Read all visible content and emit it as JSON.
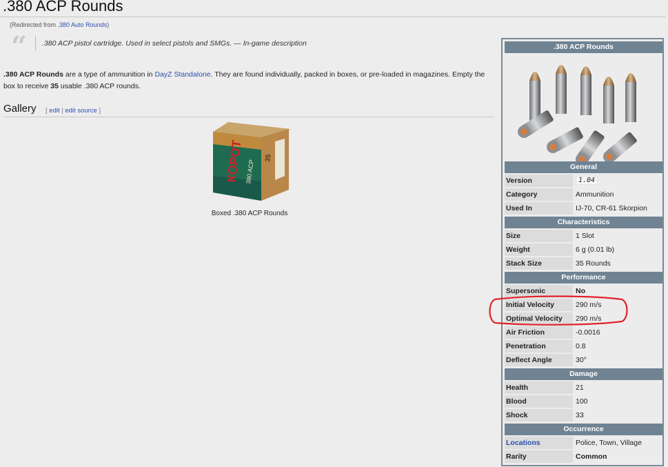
{
  "page": {
    "title": ".380 ACP Rounds",
    "redirect_prefix": "(Redirected from ",
    "redirect_link": ".380 Auto Rounds",
    "redirect_suffix": ")"
  },
  "quote": {
    "text": ".380 ACP pistol cartridge. Used in select pistols and SMGs. — In-game description"
  },
  "intro": {
    "subject": ".380 ACP Rounds",
    "text1": " are a type of ammunition in ",
    "game_link": "DayZ Standalone",
    "text2": ". They are found individually, packed in boxes, or pre-loaded in magazines. Empty the box to receive ",
    "count": "35",
    "text3": " usable .380 ACP rounds."
  },
  "gallery": {
    "heading": "Gallery",
    "edit_open": "[ ",
    "edit": "edit",
    "edit_sep": " | ",
    "edit_source": "edit source",
    "edit_close": " ]",
    "box_caption": "Boxed .380 ACP Rounds",
    "box_brand": "КОРОТ",
    "box_side": "380 ACP",
    "box_count": "35"
  },
  "infobox": {
    "title": ".380 ACP Rounds",
    "general_header": "General",
    "general": [
      {
        "label": "Version",
        "value": "1.04"
      },
      {
        "label": "Category",
        "value": "Ammunition"
      },
      {
        "label": "Used In",
        "value": "IJ-70, CR-61 Skorpion"
      }
    ],
    "characteristics_header": "Characteristics",
    "characteristics": [
      {
        "label": "Size",
        "value": "1 Slot"
      },
      {
        "label": "Weight",
        "value": "6 g (0.01 lb)"
      },
      {
        "label": "Stack Size",
        "value": "35 Rounds"
      }
    ],
    "performance_header": "Performance",
    "performance": [
      {
        "label": "Supersonic",
        "value": "No"
      },
      {
        "label": "Initial Velocity",
        "value": "290 m/s"
      },
      {
        "label": "Optimal Velocity",
        "value": "290 m/s"
      },
      {
        "label": "Air Friction",
        "value": "-0.0016"
      },
      {
        "label": "Penetration",
        "value": "0.8"
      },
      {
        "label": "Deflect Angle",
        "value": "30°"
      }
    ],
    "damage_header": "Damage",
    "damage": [
      {
        "label": "Health",
        "value": "21"
      },
      {
        "label": "Blood",
        "value": "100"
      },
      {
        "label": "Shock",
        "value": "33"
      }
    ],
    "occurrence_header": "Occurrence",
    "occurrence": [
      {
        "label": "Locations",
        "value": "Police, Town, Village"
      },
      {
        "label": "Rarity",
        "value": "Common"
      }
    ]
  },
  "colors": {
    "header_bg": "#6f8393",
    "link": "#2a4fb0",
    "annotation": "#e0222a"
  }
}
